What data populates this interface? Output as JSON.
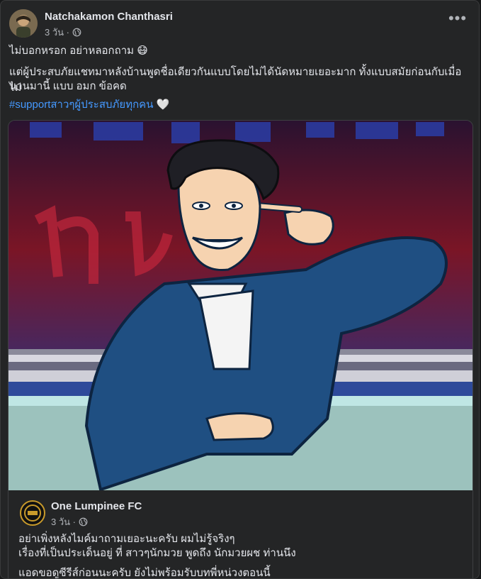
{
  "post": {
    "author": "Natchakamon Chanthasri",
    "time": "3 วัน ·",
    "more_label": "•••",
    "lines": [
      "ไม่บอกหรอก อย่าหลอกถาม 😷",
      "แต่ผู้ประสบภัยแชทมาหลังบ้านพูดชื่อเดียวกันแบบโดยไม่ได้นัดหมายเยอะมาก ทั้งแบบสมัยก่อนกับเมื่อไม่",
      "นานมานี้ แบบ อมก ข้อคด"
    ],
    "hashtag": "#supportสาวๆผู้ประสบภัยทุกคน",
    "emoji": "🤍"
  },
  "shared_post": {
    "page_name": "One Lumpinee FC",
    "time": "3 วัน ·",
    "lines": [
      "อย่าเพิ่งหลังไมค์มาถามเยอะนะครับ ผมไม่รู้จริงๆ",
      "เรื่องที่เป็นประเด็นอยู่ ที่ สาวๆนักมวย พูดถึง นักมวยผช ท่านนึง",
      "แอดขอดูซีรีส์ก่อนนะครับ ยังไม่พร้อมรับบทพี่หน่วงตอนนี้"
    ]
  },
  "icons": {
    "privacy": "globe-icon",
    "more": "more-options-icon"
  }
}
